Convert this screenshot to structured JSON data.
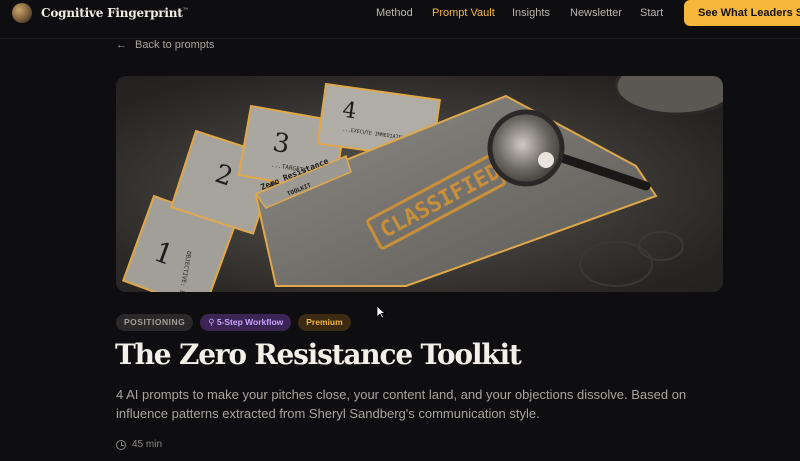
{
  "nav": {
    "brand": "Cognitive Fingerprint",
    "trademark": "™",
    "items": [
      "Method",
      "Prompt Vault",
      "Insights",
      "Newsletter",
      "Start"
    ],
    "active": "Prompt Vault",
    "cta_label": "See What Leaders See",
    "accent": "#f6b73c"
  },
  "back_link": "Back to prompts",
  "hero": {
    "card_numbers": [
      "1",
      "2",
      "3",
      "4"
    ],
    "card_texts": [
      "OBJECTIVE: ELIMINATE",
      "...TARGETS THE",
      "...EXECUTE IMMEDIATELY..."
    ],
    "folder_tab": [
      "Zero Resistance",
      "TOOLKIT"
    ],
    "stamp": "CLASSIFIED"
  },
  "badges": {
    "category": "POSITIONING",
    "workflow": "5-Step Workflow",
    "tier": "Premium"
  },
  "title": "The Zero Resistance Toolkit",
  "description": "4 AI prompts to make your pitches close, your content land, and your objections dissolve. Based on influence patterns extracted from Sheryl Sandberg's communication style.",
  "duration": "45 min"
}
